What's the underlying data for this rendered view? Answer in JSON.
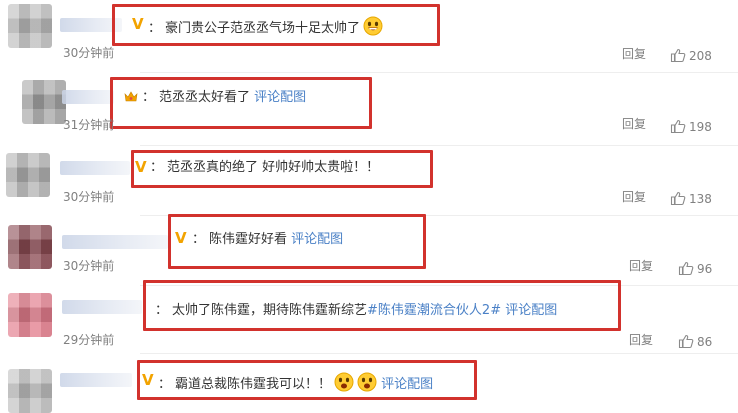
{
  "comments": [
    {
      "time": "30分钟前",
      "reply": "回复",
      "likes": "208",
      "pre": "：",
      "text": "豪门贵公子范丞丞气场十足太帅了",
      "link": ""
    },
    {
      "time": "31分钟前",
      "reply": "回复",
      "likes": "198",
      "pre": "：",
      "text": "范丞丞太好看了",
      "link": "评论配图"
    },
    {
      "time": "30分钟前",
      "reply": "回复",
      "likes": "138",
      "pre": "：",
      "text": "范丞丞真的绝了 好帅好帅太贵啦！！",
      "link": ""
    },
    {
      "time": "30分钟前",
      "reply": "回复",
      "likes": "96",
      "pre": "：",
      "text": "陈伟霆好好看",
      "link": "评论配图"
    },
    {
      "time": "29分钟前",
      "reply": "回复",
      "likes": "86",
      "pre": "：",
      "text": "太帅了陈伟霆，期待陈伟霆新综艺",
      "hashtag": "#陈伟霆潮流合伙人2#",
      "link": "评论配图"
    },
    {
      "time": "",
      "reply": "",
      "likes": "",
      "pre": "：",
      "text": "霸道总裁陈伟霆我可以！！",
      "link": "评论配图"
    }
  ],
  "icons": {
    "verified_badge": "v-badge-icon",
    "crown_badge": "crown-icon",
    "like": "thumbs-up-icon",
    "emoji": "grin-emoji-icon"
  },
  "colors": {
    "highlight_box": "#d2322d",
    "link": "#4a80c6",
    "badge": "#f2a300"
  }
}
